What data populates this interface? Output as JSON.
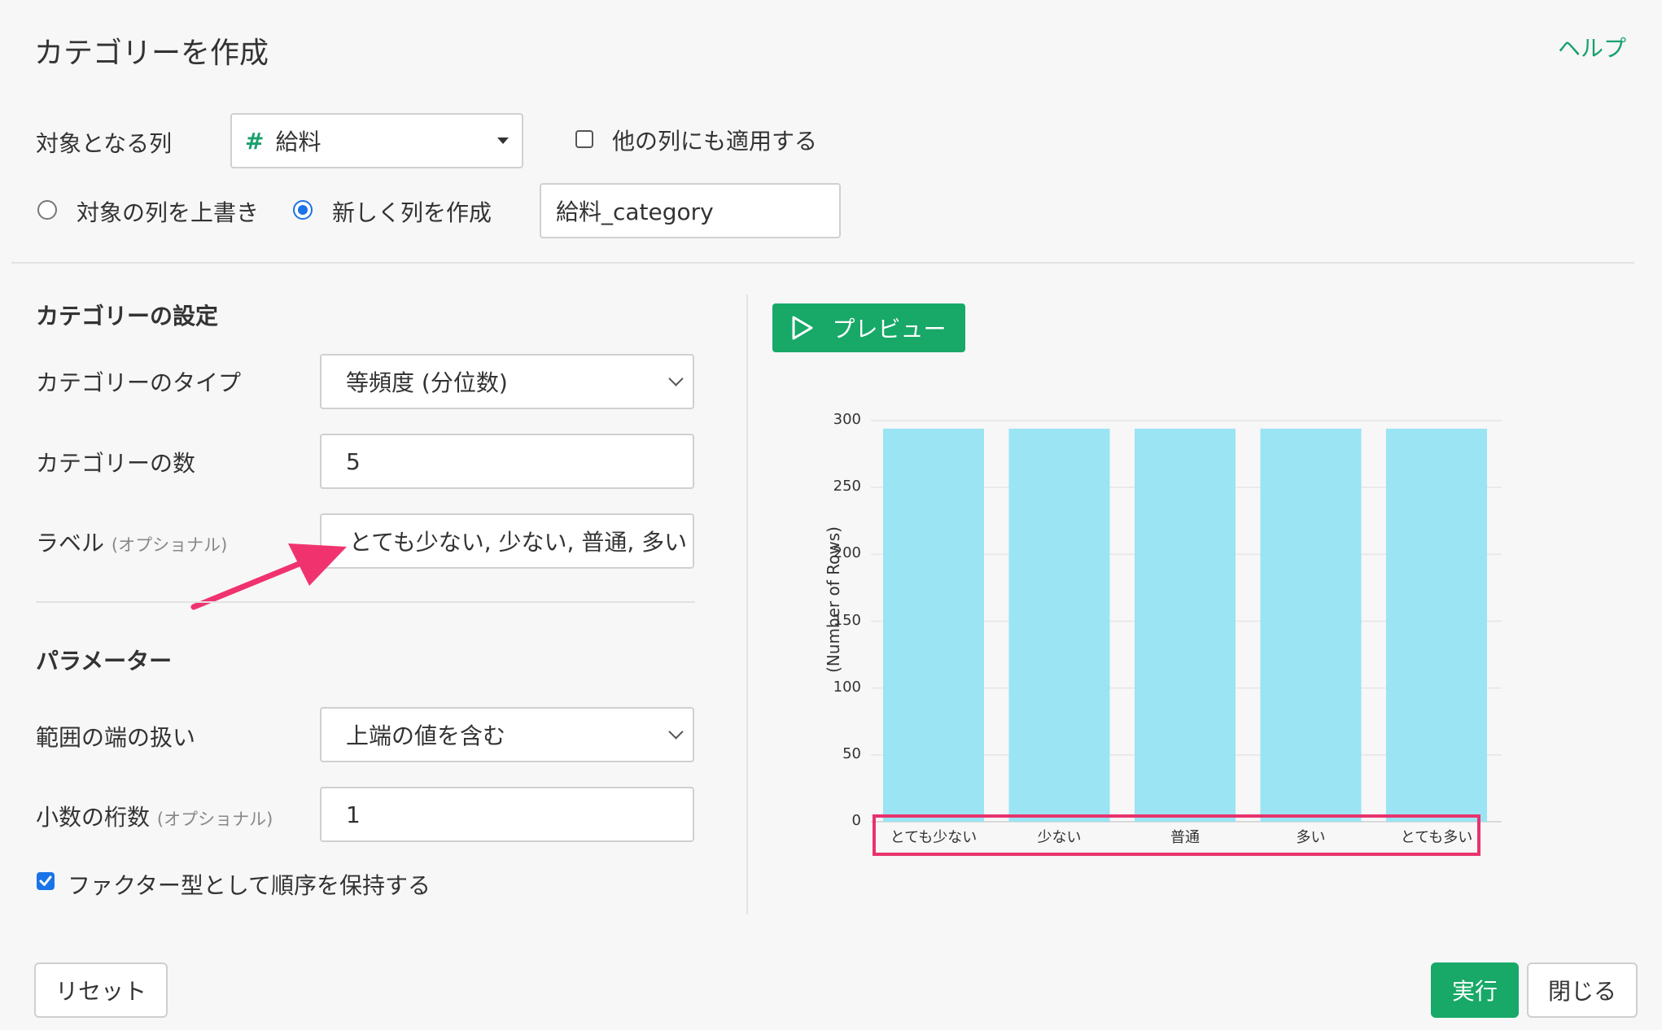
{
  "dialog": {
    "title": "カテゴリーを作成",
    "help_label": "ヘルプ"
  },
  "target": {
    "label": "対象となる列",
    "column_icon": "#",
    "column_value": "給料",
    "apply_others_label": "他の列にも適用する",
    "overwrite_label": "対象の列を上書き",
    "new_column_label": "新しく列を作成",
    "new_column_name": "給料_category"
  },
  "settings": {
    "heading": "カテゴリーの設定",
    "type_label": "カテゴリーのタイプ",
    "type_value": "等頻度 (分位数)",
    "count_label": "カテゴリーの数",
    "count_value": "5",
    "labels_label": "ラベル",
    "optional": "(オプショナル)",
    "labels_value": "とても少ない, 少ない, 普通, 多い"
  },
  "params": {
    "heading": "パラメーター",
    "edge_label": "範囲の端の扱い",
    "edge_value": "上端の値を含む",
    "decimal_label": "小数の桁数",
    "optional": "(オプショナル)",
    "decimal_value": "1",
    "factor_label": "ファクター型として順序を保持する"
  },
  "preview": {
    "button_label": "プレビュー"
  },
  "chart_data": {
    "type": "bar",
    "categories": [
      "とても少ない",
      "少ない",
      "普通",
      "多い",
      "とても多い"
    ],
    "values": [
      294,
      294,
      294,
      294,
      294
    ],
    "ylabel": "(Number of Rows)",
    "ylim": [
      0,
      300
    ],
    "yticks": [
      0,
      50,
      100,
      150,
      200,
      250,
      300
    ],
    "bar_color": "#9ae4f4",
    "highlight_color": "#e8336d"
  },
  "footer": {
    "reset_label": "リセット",
    "run_label": "実行",
    "close_label": "閉じる"
  }
}
